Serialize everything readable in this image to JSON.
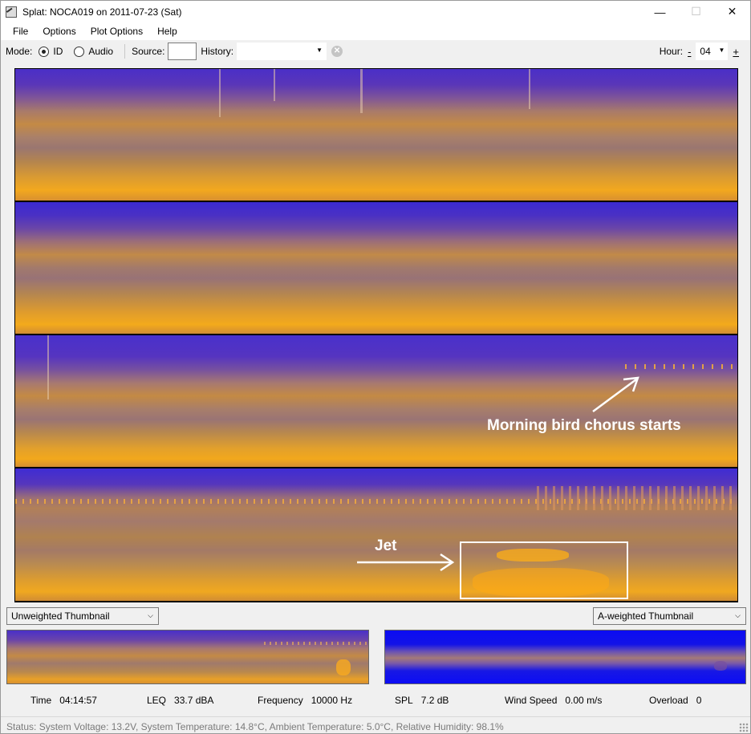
{
  "window": {
    "title": "Splat: NOCA019 on 2011-07-23 (Sat)",
    "minimize_glyph": "—",
    "maximize_glyph": "☐",
    "close_glyph": "✕"
  },
  "menu": [
    "File",
    "Options",
    "Plot Options",
    "Help"
  ],
  "toolbar": {
    "mode_label": "Mode:",
    "mode_options": [
      "ID",
      "Audio"
    ],
    "mode_selected": "ID",
    "source_label": "Source:",
    "source_value": "",
    "history_label": "History:",
    "history_value": "",
    "hour_label": "Hour:",
    "hour_minus": "-",
    "hour_value": "04",
    "hour_plus": "+"
  },
  "annotations": {
    "bird_chorus": "Morning bird chorus starts",
    "jet": "Jet"
  },
  "thumbnails": {
    "left_select": "Unweighted Thumbnail",
    "right_select": "A-weighted Thumbnail"
  },
  "readouts": {
    "time_label": "Time",
    "time_value": "04:14:57",
    "leq_label": "LEQ",
    "leq_value": "33.7 dBA",
    "freq_label": "Frequency",
    "freq_value": "10000 Hz",
    "spl_label": "SPL",
    "spl_value": "7.2 dB",
    "wind_label": "Wind Speed",
    "wind_value": "0.00 m/s",
    "overload_label": "Overload",
    "overload_value": "0"
  },
  "status": "Status: System Voltage: 13.2V, System Temperature: 14.8°C, Ambient Temperature: 5.0°C, Relative Humidity: 98.1%",
  "colors": {
    "spectrogram_low": "#3b2ad2",
    "spectrogram_high": "#f3aa1c",
    "a_weighted_low": "#0c0cf2"
  }
}
